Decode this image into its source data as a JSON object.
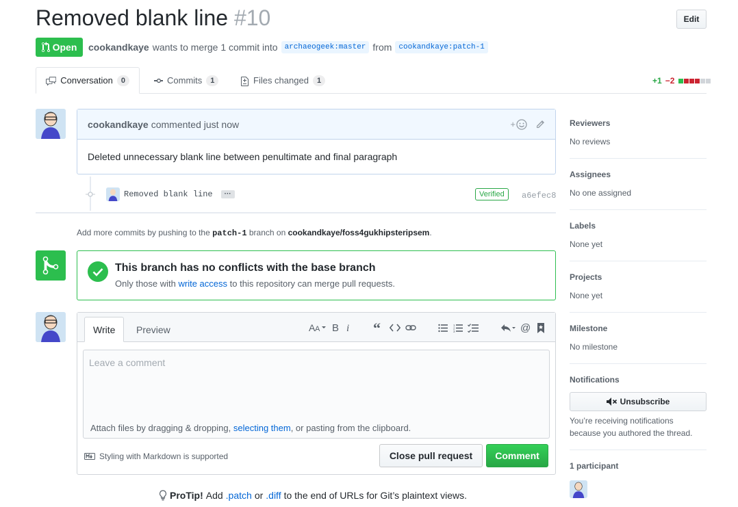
{
  "header": {
    "title": "Removed blank line",
    "number": "#10",
    "edit_label": "Edit",
    "state_label": "Open",
    "author": "cookandkaye",
    "merge_text": "wants to merge 1 commit into",
    "base_ref": "archaeogeek:master",
    "from_text": "from",
    "head_ref": "cookandkaye:patch-1"
  },
  "tabs": [
    {
      "label": "Conversation",
      "count": "0"
    },
    {
      "label": "Commits",
      "count": "1"
    },
    {
      "label": "Files changed",
      "count": "1"
    }
  ],
  "diffstat": {
    "additions": "+1",
    "deletions": "−2",
    "colors": [
      "#2cbe4e",
      "#cb2431",
      "#cb2431",
      "#cb2431",
      "#d1d5da",
      "#d1d5da"
    ]
  },
  "comment": {
    "author": "cookandkaye",
    "action": "commented just now",
    "body": "Deleted unnecessary blank line between penultimate and final paragraph"
  },
  "commit": {
    "message": "Removed blank line",
    "ellipsis": "···",
    "verified": "Verified",
    "sha": "a6efec8"
  },
  "help": {
    "prefix": "Add more commits by pushing to the",
    "branch": "patch-1",
    "middle": "branch on",
    "repo": "cookandkaye/foss4gukhipsteripsem",
    "suffix": "."
  },
  "merge": {
    "title": "This branch has no conflicts with the base branch",
    "sub_prefix": "Only those with",
    "sub_link": "write access",
    "sub_suffix": "to this repository can merge pull requests."
  },
  "editor": {
    "tab_write": "Write",
    "tab_preview": "Preview",
    "placeholder": "Leave a comment",
    "attach_prefix": "Attach files by dragging & dropping,",
    "attach_link": "selecting them",
    "attach_suffix": ", or pasting from the clipboard.",
    "markdown_note": "Styling with Markdown is supported",
    "close_label": "Close pull request",
    "comment_label": "Comment"
  },
  "protip": {
    "bold": "ProTip!",
    "text1": "Add",
    "link1": ".patch",
    "text2": "or",
    "link2": ".diff",
    "text3": "to the end of URLs for Git’s plaintext views."
  },
  "sidebar": {
    "reviewers_label": "Reviewers",
    "reviewers_value": "No reviews",
    "assignees_label": "Assignees",
    "assignees_value": "No one assigned",
    "labels_label": "Labels",
    "labels_value": "None yet",
    "projects_label": "Projects",
    "projects_value": "None yet",
    "milestone_label": "Milestone",
    "milestone_value": "No milestone",
    "notifications_label": "Notifications",
    "unsubscribe_label": "Unsubscribe",
    "notifications_text": "You’re receiving notifications because you authored the thread.",
    "participants_label": "1 participant"
  },
  "colors": {
    "green": "#2cbe4e",
    "blue": "#0366d6",
    "red": "#cb2431"
  }
}
